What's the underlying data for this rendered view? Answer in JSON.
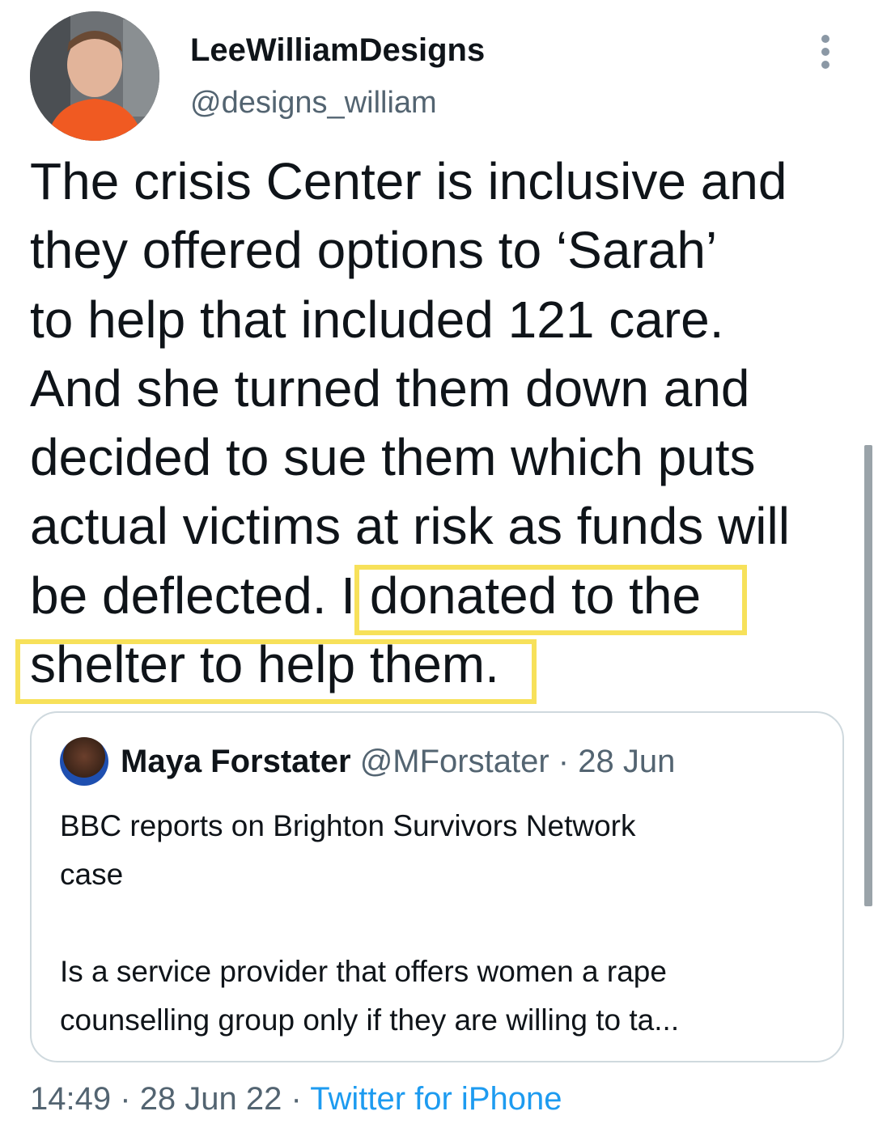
{
  "tweet": {
    "author_name": "LeeWilliamDesigns",
    "author_handle": "@designs_william",
    "text_before_highlight": "The crisis Center is inclusive and\nthey offered options to ‘Sarah’\nto help that included 121 care.\nAnd she turned them down and\ndecided to sue them which puts\nactual victims at risk as funds will\nbe deflected. ",
    "text_highlight_part1": "I donated to the",
    "text_highlight_part2": "shelter to help them.",
    "time": "14:49",
    "date": "28 Jun 22",
    "source": "Twitter for iPhone"
  },
  "quoted_tweet": {
    "author_name": "Maya Forstater",
    "author_handle": "@MForstater",
    "date": "28 Jun",
    "text": "BBC reports on Brighton Survivors Network\ncase\n\nIs a service provider that offers women a rape\ncounselling group only if they are willing to ta..."
  },
  "colors": {
    "highlight": "#f7e15a",
    "link": "#1d9bf0",
    "muted": "#536471"
  },
  "icons": {
    "more": "more-vertical-icon"
  }
}
